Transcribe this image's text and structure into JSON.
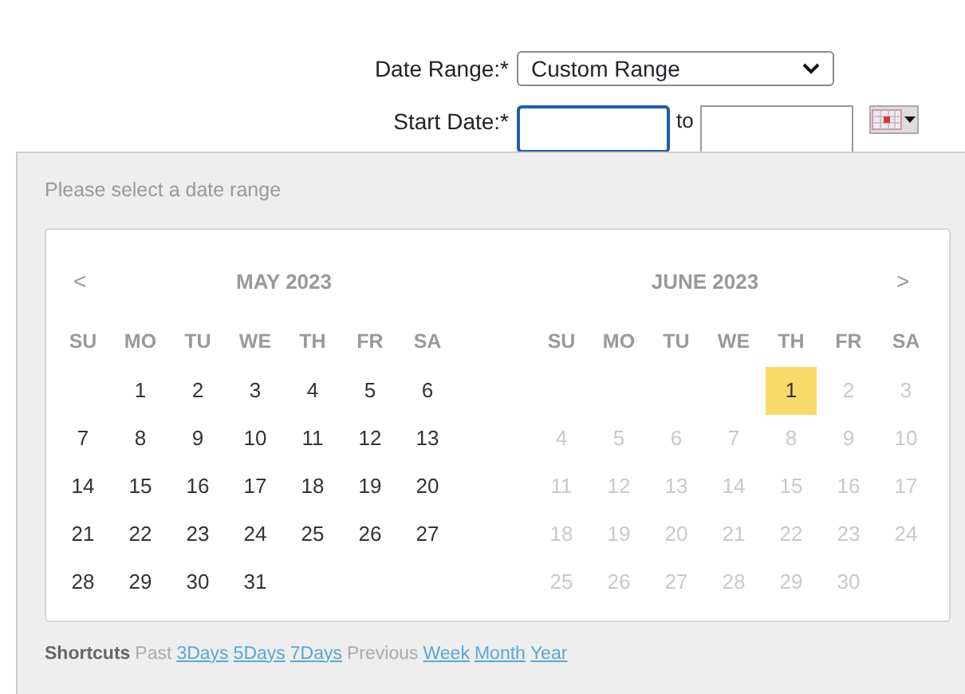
{
  "form": {
    "date_range": {
      "label": "Date Range:*",
      "value": "Custom Range"
    },
    "start_date": {
      "label": "Start Date:*",
      "focused": true,
      "to_label": "to"
    }
  },
  "picker": {
    "prompt": "Please select a date range",
    "prev": "<",
    "next": ">",
    "months": [
      {
        "title": "MAY 2023",
        "weekdays": [
          "SU",
          "MO",
          "TU",
          "WE",
          "TH",
          "FR",
          "SA"
        ],
        "weeks": [
          [
            {
              "day": "1",
              "disabled": false,
              "selected": false
            },
            {
              "day": "2",
              "disabled": false,
              "selected": false
            },
            {
              "day": "3",
              "disabled": false,
              "selected": false
            },
            {
              "day": "4",
              "disabled": false,
              "selected": false
            },
            {
              "day": "5",
              "disabled": false,
              "selected": false
            },
            {
              "day": "6",
              "disabled": false,
              "selected": false
            }
          ],
          [
            {
              "day": "7",
              "disabled": false,
              "selected": false
            },
            {
              "day": "8",
              "disabled": false,
              "selected": false
            },
            {
              "day": "9",
              "disabled": false,
              "selected": false
            },
            {
              "day": "10",
              "disabled": false,
              "selected": false
            },
            {
              "day": "11",
              "disabled": false,
              "selected": false
            },
            {
              "day": "12",
              "disabled": false,
              "selected": false
            },
            {
              "day": "13",
              "disabled": false,
              "selected": false
            }
          ],
          [
            {
              "day": "14",
              "disabled": false,
              "selected": false
            },
            {
              "day": "15",
              "disabled": false,
              "selected": false
            },
            {
              "day": "16",
              "disabled": false,
              "selected": false
            },
            {
              "day": "17",
              "disabled": false,
              "selected": false
            },
            {
              "day": "18",
              "disabled": false,
              "selected": false
            },
            {
              "day": "19",
              "disabled": false,
              "selected": false
            },
            {
              "day": "20",
              "disabled": false,
              "selected": false
            }
          ],
          [
            {
              "day": "21",
              "disabled": false,
              "selected": false
            },
            {
              "day": "22",
              "disabled": false,
              "selected": false
            },
            {
              "day": "23",
              "disabled": false,
              "selected": false
            },
            {
              "day": "24",
              "disabled": false,
              "selected": false
            },
            {
              "day": "25",
              "disabled": false,
              "selected": false
            },
            {
              "day": "26",
              "disabled": false,
              "selected": false
            },
            {
              "day": "27",
              "disabled": false,
              "selected": false
            }
          ],
          [
            {
              "day": "28",
              "disabled": false,
              "selected": false
            },
            {
              "day": "29",
              "disabled": false,
              "selected": false
            },
            {
              "day": "30",
              "disabled": false,
              "selected": false
            },
            {
              "day": "31",
              "disabled": false,
              "selected": false
            }
          ]
        ]
      },
      {
        "title": "JUNE 2023",
        "weekdays": [
          "SU",
          "MO",
          "TU",
          "WE",
          "TH",
          "FR",
          "SA"
        ],
        "weeks": [
          [
            {
              "day": "1",
              "disabled": false,
              "selected": true
            },
            {
              "day": "2",
              "disabled": true,
              "selected": false
            },
            {
              "day": "3",
              "disabled": true,
              "selected": false
            }
          ],
          [
            {
              "day": "4",
              "disabled": true,
              "selected": false
            },
            {
              "day": "5",
              "disabled": true,
              "selected": false
            },
            {
              "day": "6",
              "disabled": true,
              "selected": false
            },
            {
              "day": "7",
              "disabled": true,
              "selected": false
            },
            {
              "day": "8",
              "disabled": true,
              "selected": false
            },
            {
              "day": "9",
              "disabled": true,
              "selected": false
            },
            {
              "day": "10",
              "disabled": true,
              "selected": false
            }
          ],
          [
            {
              "day": "11",
              "disabled": true,
              "selected": false
            },
            {
              "day": "12",
              "disabled": true,
              "selected": false
            },
            {
              "day": "13",
              "disabled": true,
              "selected": false
            },
            {
              "day": "14",
              "disabled": true,
              "selected": false
            },
            {
              "day": "15",
              "disabled": true,
              "selected": false
            },
            {
              "day": "16",
              "disabled": true,
              "selected": false
            },
            {
              "day": "17",
              "disabled": true,
              "selected": false
            }
          ],
          [
            {
              "day": "18",
              "disabled": true,
              "selected": false
            },
            {
              "day": "19",
              "disabled": true,
              "selected": false
            },
            {
              "day": "20",
              "disabled": true,
              "selected": false
            },
            {
              "day": "21",
              "disabled": true,
              "selected": false
            },
            {
              "day": "22",
              "disabled": true,
              "selected": false
            },
            {
              "day": "23",
              "disabled": true,
              "selected": false
            },
            {
              "day": "24",
              "disabled": true,
              "selected": false
            }
          ],
          [
            {
              "day": "25",
              "disabled": true,
              "selected": false
            },
            {
              "day": "26",
              "disabled": true,
              "selected": false
            },
            {
              "day": "27",
              "disabled": true,
              "selected": false
            },
            {
              "day": "28",
              "disabled": true,
              "selected": false
            },
            {
              "day": "29",
              "disabled": true,
              "selected": false
            },
            {
              "day": "30",
              "disabled": true,
              "selected": false
            }
          ]
        ]
      }
    ],
    "shortcuts": [
      {
        "kind": "heading",
        "text": "Shortcuts"
      },
      {
        "kind": "label",
        "text": "Past"
      },
      {
        "kind": "link",
        "text": "3Days"
      },
      {
        "kind": "link",
        "text": "5Days"
      },
      {
        "kind": "link",
        "text": "7Days"
      },
      {
        "kind": "label",
        "text": "Previous"
      },
      {
        "kind": "link",
        "text": "Week"
      },
      {
        "kind": "link",
        "text": "Month"
      },
      {
        "kind": "link",
        "text": "Year"
      }
    ]
  }
}
